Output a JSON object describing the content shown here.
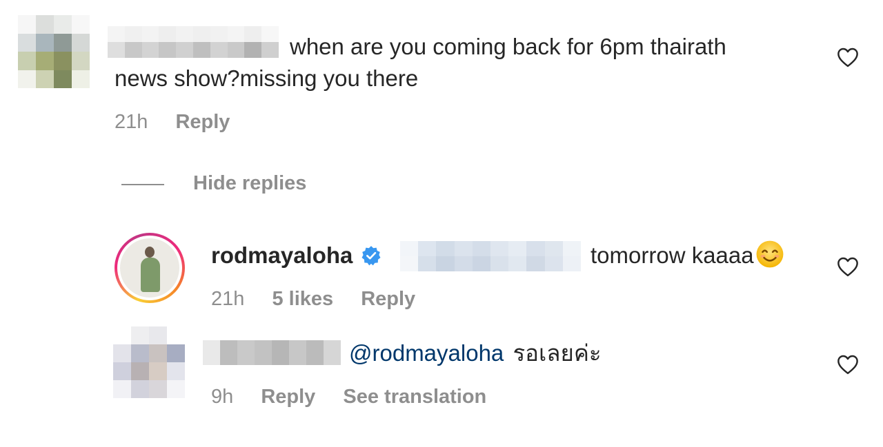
{
  "comment1": {
    "text_line1": "when are you coming back for 6pm thairath",
    "text_line2": "news show?missing you there",
    "time": "21h",
    "reply_label": "Reply"
  },
  "hide_replies_label": "Hide replies",
  "reply1": {
    "username": "rodmayaloha",
    "text": "tomorrow kaaaa",
    "time": "21h",
    "likes": "5 likes",
    "reply_label": "Reply"
  },
  "reply2": {
    "mention": "@rodmayaloha",
    "text": "รอเลยค่ะ",
    "time": "9h",
    "reply_label": "Reply",
    "translate_label": "See translation"
  },
  "icons": {
    "like": "heart-icon",
    "verified": "verified-badge-icon",
    "emoji": "smiling-face-emoji"
  },
  "colors": {
    "text": "#262626",
    "secondary": "#8e8e8e",
    "mention": "#00376b",
    "verified": "#3897f0"
  }
}
